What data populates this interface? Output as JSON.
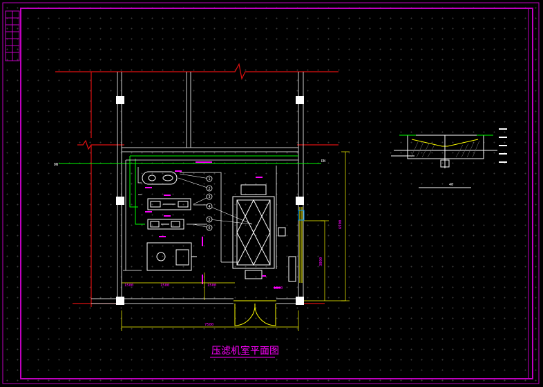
{
  "drawing": {
    "title": "压滤机室平面图",
    "section_title": "",
    "section_scale": "40",
    "colors": {
      "background": "#000000",
      "frame": "#c000c0",
      "wall": "#e01010",
      "column": "#ffffff",
      "equipment": "#ffffff",
      "pipe": "#00ff00",
      "dimension": "#ffff00",
      "annotation": "#ff00ff",
      "leader": "#00c0c0"
    }
  },
  "dimensions": {
    "overall_width": "7500",
    "right_total": "6900",
    "right_part": "3000",
    "bottom_a": "1500",
    "bottom_b": "1500",
    "bottom_c": "1500",
    "door": "1800"
  },
  "labels": {
    "pipe_left": "DN",
    "pipe_right": "DN",
    "callout_1": "1",
    "callout_2": "2",
    "callout_3": "3",
    "callout_4": "4",
    "callout_5": "5",
    "callout_6": "6"
  }
}
